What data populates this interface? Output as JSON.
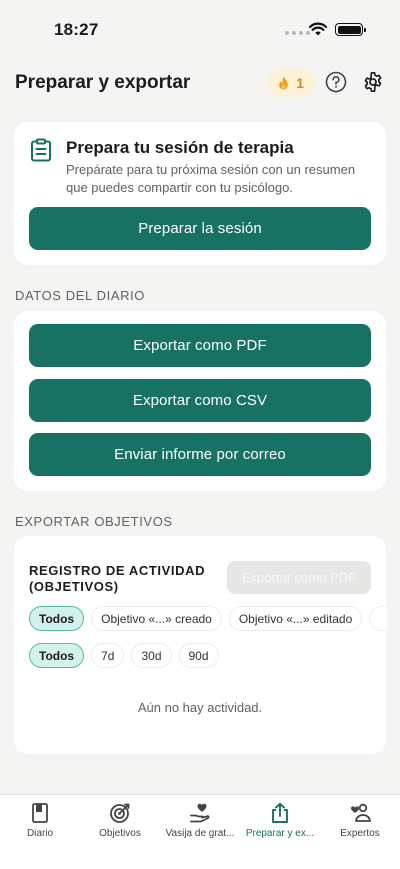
{
  "status_bar": {
    "time": "18:27"
  },
  "header": {
    "title": "Preparar y exportar",
    "streak_count": "1",
    "icons": {
      "streak": "flame-icon",
      "help": "help-circle-icon",
      "settings": "gear-icon"
    }
  },
  "session_card": {
    "icon": "clipboard-icon",
    "title": "Prepara tu sesión de terapia",
    "description": "Prepárate para tu próxima sesión con un resumen que puedes compartir con tu psicólogo.",
    "button_label": "Preparar la sesión"
  },
  "diary_section": {
    "label": "DATOS DEL DIARIO",
    "buttons": {
      "export_pdf": "Exportar como PDF",
      "export_csv": "Exportar como CSV",
      "email_report": "Enviar informe por correo"
    }
  },
  "goals_section": {
    "label": "EXPORTAR OBJETIVOS",
    "activity_title": "REGISTRO DE ACTIVIDAD (OBJETIVOS)",
    "export_pdf_label": "Exportar como PDF",
    "type_filters": [
      "Todos",
      "Objetivo «...» creado",
      "Objetivo «...» editado"
    ],
    "range_filters": [
      "Todos",
      "7d",
      "30d",
      "90d"
    ],
    "empty_text": "Aún no hay actividad."
  },
  "tabs": [
    {
      "label": "Diario",
      "icon": "book-icon"
    },
    {
      "label": "Objetivos",
      "icon": "target-icon"
    },
    {
      "label": "Vasija de grat...",
      "icon": "heart-hand-icon"
    },
    {
      "label": "Preparar y ex...",
      "icon": "share-icon"
    },
    {
      "label": "Expertos",
      "icon": "experts-icon"
    }
  ],
  "colors": {
    "accent": "#177264",
    "background": "#f4f4f2",
    "chip_active": "#d3f1eb",
    "streak_bg": "#fdf1d8"
  }
}
